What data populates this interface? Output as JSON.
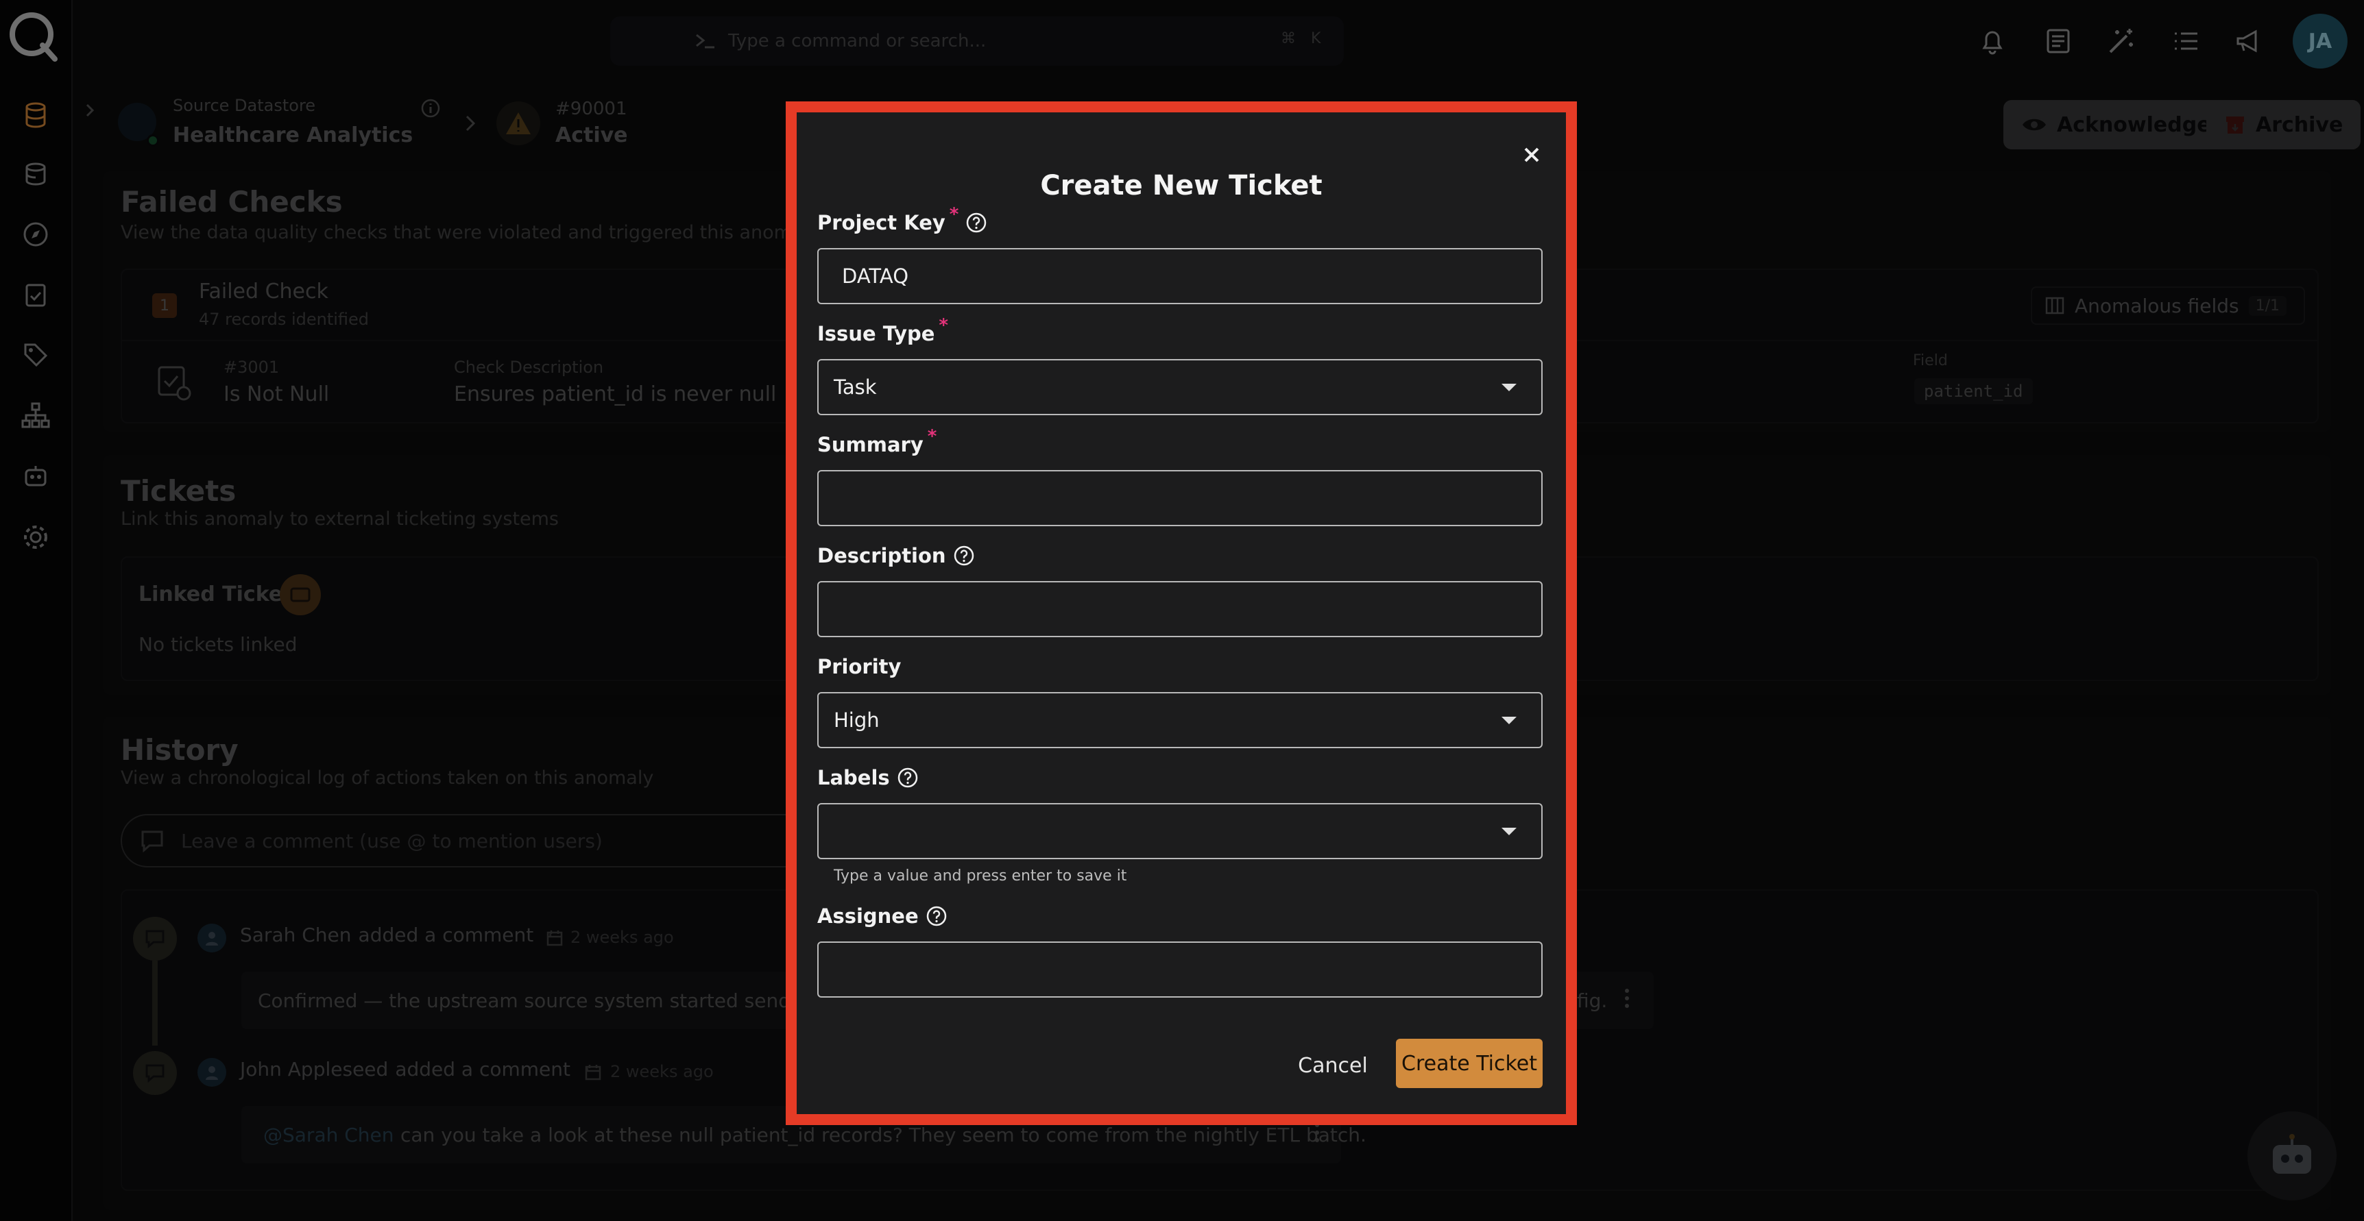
{
  "command_bar": {
    "placeholder": "Type a command or search...",
    "shortcut_mod": "⌘",
    "shortcut_key": "K"
  },
  "user": {
    "initials": "JA"
  },
  "header": {
    "datastore_label": "Source Datastore",
    "datastore_name": "Healthcare Analytics",
    "anomaly_id": "#90001",
    "anomaly_status": "Active",
    "acknowledge_label": "Acknowledge",
    "archive_label": "Archive"
  },
  "failed_checks": {
    "title": "Failed Checks",
    "subtitle": "View the data quality checks that were violated and triggered this anomaly",
    "count": "1",
    "heading": "Failed Check",
    "records": "47 records identified",
    "anomalous_fields_label": "Anomalous fields",
    "anomalous_fields_count": "1/1",
    "check": {
      "id": "#3001",
      "name": "Is Not Null",
      "description_label": "Check Description",
      "description": "Ensures patient_id is never null",
      "field_label": "Field",
      "field": "patient_id"
    }
  },
  "tickets": {
    "title": "Tickets",
    "subtitle": "Link this anomaly to external ticketing systems",
    "linked_label": "Linked Tickets",
    "empty": "No tickets linked"
  },
  "history": {
    "title": "History",
    "subtitle": "View a chronological log of actions taken on this anomaly",
    "comment_placeholder": "Leave a comment (use @ to mention users)",
    "entries": [
      {
        "actor": "Sarah Chen",
        "action": "added a comment",
        "sep": "·",
        "time": "2 weeks ago",
        "text": "Confirmed — the upstream source system started sending",
        "tail": "fig."
      },
      {
        "actor": "John Appleseed",
        "action": "added a comment",
        "sep": "·",
        "time": "2 weeks ago",
        "mention": "@Sarah Chen",
        "text": "can you take a look at these null patient_id records? They seem to come from the nightly ETL batch."
      }
    ]
  },
  "modal": {
    "title": "Create New Ticket",
    "fields": {
      "project_key": {
        "label": "Project Key",
        "required_mark": "*",
        "value": "DATAQ"
      },
      "issue_type": {
        "label": "Issue Type",
        "required_mark": "*",
        "value": "Task"
      },
      "summary": {
        "label": "Summary",
        "required_mark": "*",
        "value": ""
      },
      "description": {
        "label": "Description",
        "value": ""
      },
      "priority": {
        "label": "Priority",
        "value": "High"
      },
      "labels": {
        "label": "Labels",
        "value": "",
        "hint": "Type a value and press enter to save it"
      },
      "assignee": {
        "label": "Assignee",
        "value": ""
      }
    },
    "cancel_label": "Cancel",
    "create_label": "Create Ticket"
  },
  "colors": {
    "accent": "#d28b3d",
    "highlight_frame": "#e53b26",
    "required": "#e3337a",
    "status_ok": "#2fc46b"
  }
}
